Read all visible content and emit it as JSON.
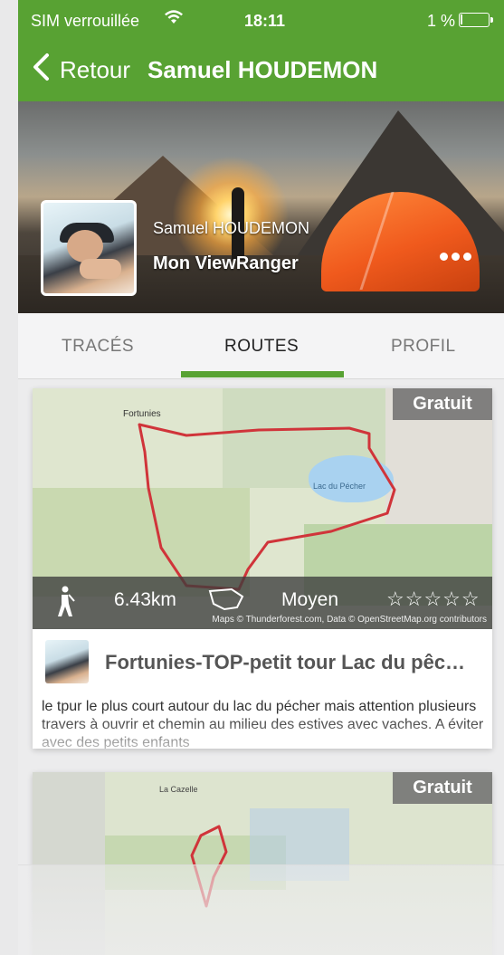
{
  "status": {
    "carrier": "SIM verrouillée",
    "time": "18:11",
    "battery": "1 %"
  },
  "nav": {
    "back_label": "Retour",
    "title": "Samuel HOUDEMON"
  },
  "profile": {
    "name": "Samuel HOUDEMON",
    "subtitle": "Mon ViewRanger",
    "more_icon": "more-dots-icon"
  },
  "tabs": [
    {
      "label": "TRACÉS"
    },
    {
      "label": "ROUTES"
    },
    {
      "label": "PROFIL"
    }
  ],
  "active_tab": "ROUTES",
  "routes": [
    {
      "badge": "Gratuit",
      "map_labels": {
        "town": "Fortunies",
        "lake": "Lac du Pécher"
      },
      "distance": "6.43km",
      "route_shape_icon": "loop-route-icon",
      "difficulty": "Moyen",
      "stars": "☆☆☆☆☆",
      "map_credit": "Maps © Thunderforest.com, Data © OpenStreetMap.org contributors",
      "title": "Fortunies-TOP-petit tour Lac du pêc…",
      "description": "le tpur le plus court autour du lac du pécher mais attention plusieurs travers à ouvrir et chemin au milieu des estives avec vaches. A éviter avec des petits enfants"
    },
    {
      "badge": "Gratuit",
      "map_labels": {
        "place": "La Cazelle"
      }
    }
  ],
  "colors": {
    "accent": "#58a233",
    "badge_bg": "#6e6e6e",
    "route_line": "#d0343a"
  }
}
